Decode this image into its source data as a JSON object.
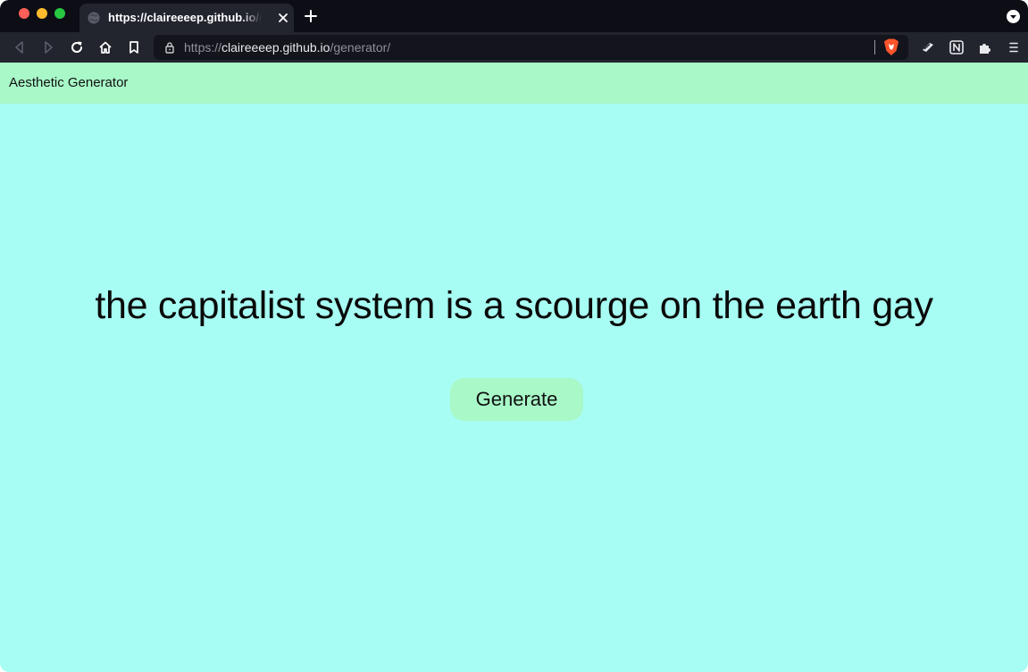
{
  "browser": {
    "tab": {
      "title": "https://claireeeep.github.io/generator/"
    },
    "address_bar": {
      "url_prefix": "https://",
      "url_host": "claireeeep.github.io",
      "url_path": "/generator/"
    },
    "colors": {
      "titlebar": "#0c0d15",
      "toolbar": "#22242e",
      "urlbar": "#14151c"
    },
    "icons": {
      "back": "back-arrow-icon",
      "forward": "forward-arrow-icon",
      "reload": "reload-icon",
      "home": "home-icon",
      "bookmark": "bookmark-icon",
      "lock": "lock-icon",
      "brave": "brave-shield-icon",
      "rewards": "rewards-icon",
      "notion": "notion-icon",
      "extensions": "puzzle-icon",
      "menu": "hamburger-menu-icon"
    }
  },
  "page": {
    "brand": "Aesthetic Generator",
    "quote": "the capitalist system is a scourge on the earth gay",
    "generate_label": "Generate",
    "colors": {
      "background": "#a7fdf3",
      "navbar": "#a8f8c8",
      "button": "#a8f8c8"
    }
  }
}
